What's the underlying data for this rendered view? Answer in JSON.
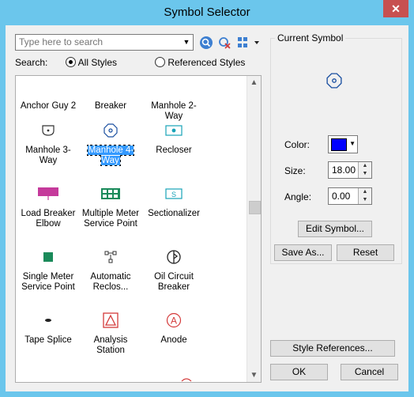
{
  "window": {
    "title": "Symbol Selector",
    "close_glyph": "✕"
  },
  "search": {
    "placeholder": "Type here to search",
    "label": "Search:",
    "options": [
      "All Styles",
      "Referenced Styles"
    ],
    "selected": "All Styles"
  },
  "toolbar": {
    "icons": [
      "search-icon",
      "clear-search-icon",
      "view-options-icon"
    ]
  },
  "symbols": [
    {
      "name": "Anchor Guy 2",
      "lines": [
        "Anchor Guy 2"
      ],
      "icon": "none",
      "selected": false
    },
    {
      "name": "Breaker",
      "lines": [
        "Breaker"
      ],
      "icon": "none",
      "selected": false
    },
    {
      "name": "Manhole 2-Way",
      "lines": [
        "Manhole 2-Way"
      ],
      "icon": "none",
      "selected": false
    },
    {
      "name": "Manhole 3-Way",
      "lines": [
        "Manhole 3-Way"
      ],
      "icon": "manhole-3-way-icon",
      "selected": false
    },
    {
      "name": "Manhole 4-Way",
      "lines": [
        "Manhole 4-Way"
      ],
      "icon": "manhole-4-way-icon",
      "selected": true
    },
    {
      "name": "Recloser",
      "lines": [
        "Recloser"
      ],
      "icon": "recloser-icon",
      "selected": false
    },
    {
      "name": "Load Breaker Elbow",
      "lines": [
        "Load Breaker",
        "Elbow"
      ],
      "icon": "load-breaker-elbow-icon",
      "selected": false
    },
    {
      "name": "Multiple Meter Service Point",
      "lines": [
        "Multiple Meter",
        "Service Point"
      ],
      "icon": "multiple-meter-icon",
      "selected": false
    },
    {
      "name": "Sectionalizer",
      "lines": [
        "Sectionalizer"
      ],
      "icon": "sectionalizer-icon",
      "selected": false
    },
    {
      "name": "Single Meter Service Point",
      "lines": [
        "Single Meter",
        "Service Point"
      ],
      "icon": "single-meter-icon",
      "selected": false
    },
    {
      "name": "Automatic Reclos...",
      "lines": [
        "Automatic",
        "Reclos..."
      ],
      "icon": "automatic-recloser-icon",
      "selected": false
    },
    {
      "name": "Oil Circuit Breaker",
      "lines": [
        "Oil Circuit",
        "Breaker"
      ],
      "icon": "oil-circuit-breaker-icon",
      "selected": false
    },
    {
      "name": "Tape Splice",
      "lines": [
        "Tape Splice"
      ],
      "icon": "tape-splice-icon",
      "selected": false
    },
    {
      "name": "Analysis Station",
      "lines": [
        "Analysis Station"
      ],
      "icon": "analysis-station-icon",
      "selected": false
    },
    {
      "name": "Anode",
      "lines": [
        "Anode"
      ],
      "icon": "anode-icon",
      "selected": false
    }
  ],
  "current_symbol": {
    "title": "Current Symbol",
    "color_label": "Color:",
    "color_value": "#0000ff",
    "size_label": "Size:",
    "size_value": "18.00",
    "angle_label": "Angle:",
    "angle_value": "0.00",
    "edit_button": "Edit Symbol...",
    "save_as_button": "Save As...",
    "reset_button": "Reset"
  },
  "buttons": {
    "style_references": "Style References...",
    "ok": "OK",
    "cancel": "Cancel"
  },
  "scrollbar": {
    "position": 0.42
  },
  "colors": {
    "title_bar": "#6bc6ec",
    "selection": "#3399ff",
    "close": "#c75050",
    "symbol_magenta": "#c53a9b",
    "symbol_green": "#1a8a5a",
    "symbol_cyan": "#18a3b8",
    "symbol_red": "#d43a3a",
    "symbol_blue": "#1a4fa0"
  }
}
